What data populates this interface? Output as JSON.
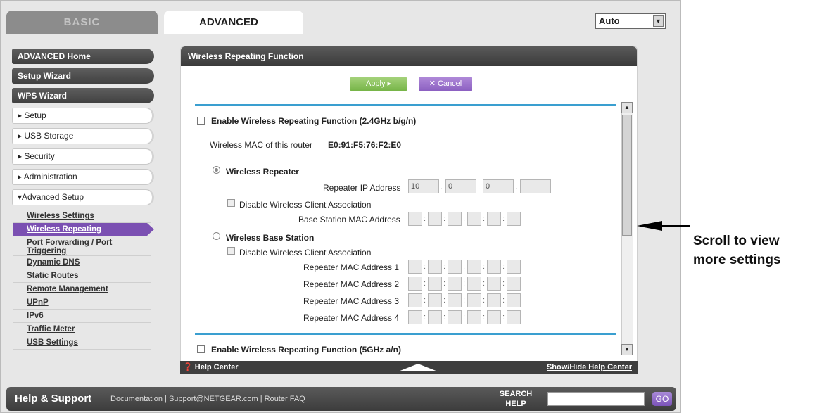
{
  "tabs": {
    "basic": "BASIC",
    "advanced": "ADVANCED"
  },
  "mode_select": {
    "value": "Auto"
  },
  "nav": {
    "dark": [
      "ADVANCED Home",
      "Setup Wizard",
      "WPS Wizard"
    ],
    "light": [
      "▸ Setup",
      "▸ USB Storage",
      "▸ Security",
      "▸ Administration",
      "▾Advanced Setup"
    ],
    "sub": [
      "Wireless Settings",
      "Wireless Repeating",
      "Port Forwarding / Port Triggering",
      "Dynamic DNS",
      "Static Routes",
      "Remote Management",
      "UPnP",
      "IPv6",
      "Traffic Meter",
      "USB Settings"
    ]
  },
  "panel": {
    "title": "Wireless Repeating Function",
    "apply": "Apply ▸",
    "cancel": "✕ Cancel",
    "enable_24": "Enable Wireless Repeating Function (2.4GHz b/g/n)",
    "mac_label": "Wireless MAC of this router",
    "mac_value": "E0:91:F5:76:F2:E0",
    "wireless_repeater": "Wireless Repeater",
    "repeater_ip_label": "Repeater IP Address",
    "repeater_ip": [
      "10",
      "0",
      "0",
      ""
    ],
    "disable_assoc": "Disable Wireless Client Association",
    "base_mac_label": "Base Station MAC Address",
    "wireless_base": "Wireless Base Station",
    "disable_assoc2": "Disable Wireless Client Association",
    "repeater_macs": [
      "Repeater MAC Address 1",
      "Repeater MAC Address 2",
      "Repeater MAC Address 3",
      "Repeater MAC Address 4"
    ],
    "enable_5": "Enable Wireless Repeating Function (5GHz a/n)"
  },
  "help_bar": {
    "left": "Help Center",
    "right": "Show/Hide Help Center"
  },
  "footer": {
    "title": "Help & Support",
    "links": "Documentation | Support@NETGEAR.com | Router FAQ",
    "search": "SEARCH HELP",
    "go": "GO"
  },
  "annotation": {
    "line1": "Scroll to view",
    "line2": "more settings"
  }
}
